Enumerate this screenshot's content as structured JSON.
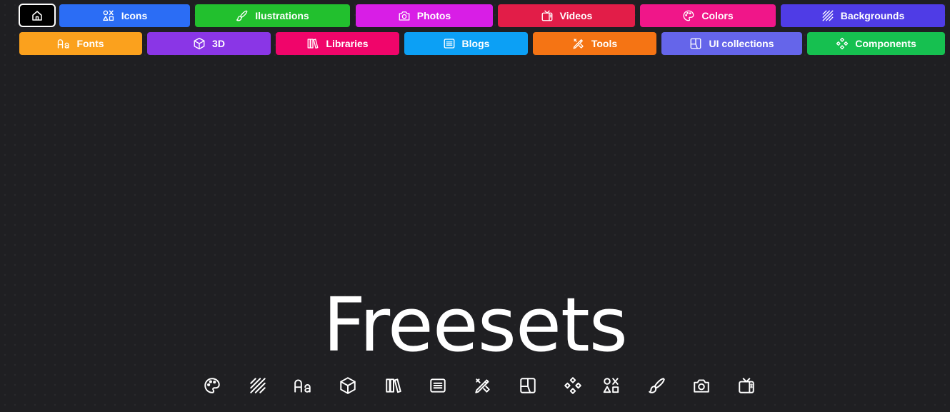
{
  "nav": {
    "row1": [
      {
        "label": "Icons",
        "icon": "shapes-icon",
        "color": "#2b6df5"
      },
      {
        "label": "Ilustrations",
        "icon": "brush-icon",
        "color": "#22c02e"
      },
      {
        "label": "Photos",
        "icon": "camera-icon",
        "color": "#d81ee6"
      },
      {
        "label": "Videos",
        "icon": "tv-icon",
        "color": "#e21d48"
      },
      {
        "label": "Colors",
        "icon": "palette-icon",
        "color": "#f01689"
      },
      {
        "label": "Backgrounds",
        "icon": "hatch-icon",
        "color": "#4f3ce6"
      }
    ],
    "row2": [
      {
        "label": "Fonts",
        "icon": "fonts-icon",
        "color": "#fba11d"
      },
      {
        "label": "3D",
        "icon": "cube-icon",
        "color": "#8a36e6"
      },
      {
        "label": "Libraries",
        "icon": "books-icon",
        "color": "#f0056a"
      },
      {
        "label": "Blogs",
        "icon": "blog-icon",
        "color": "#0ca0f5"
      },
      {
        "label": "Tools",
        "icon": "tools-icon",
        "color": "#f57414"
      },
      {
        "label": "UI collections",
        "icon": "layout-icon",
        "color": "#6565ea"
      },
      {
        "label": "Components",
        "icon": "components-icon",
        "color": "#16c050"
      }
    ]
  },
  "hero": {
    "title": "Freesets"
  },
  "bottom_icons": [
    "palette-icon",
    "hatch-icon",
    "fonts-icon",
    "cube-icon",
    "books-icon",
    "blog-icon",
    "tools-icon",
    "layout-icon",
    "components-icon",
    "shapes-icon",
    "brush-icon",
    "camera-icon",
    "tv-icon"
  ]
}
